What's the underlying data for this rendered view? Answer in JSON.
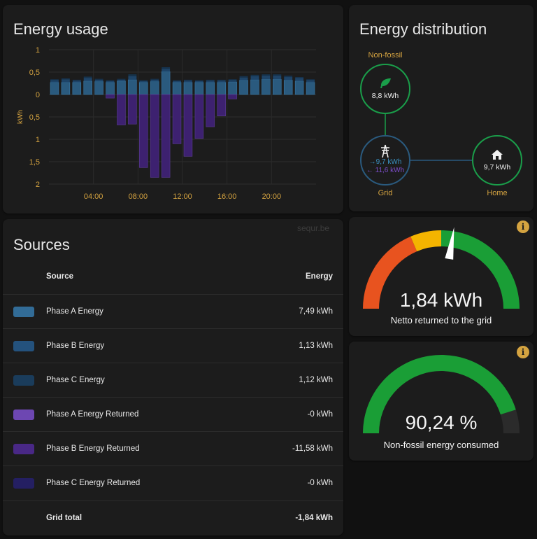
{
  "usage": {
    "title": "Energy usage",
    "unit": "kWh",
    "chart_data": {
      "type": "bar",
      "categories": [
        "00",
        "01",
        "02",
        "03",
        "04",
        "05",
        "06",
        "07",
        "08",
        "09",
        "10",
        "11",
        "12",
        "13",
        "14",
        "15",
        "16",
        "17",
        "18",
        "19",
        "20",
        "21",
        "22",
        "23"
      ],
      "x_tick_labels": [
        "04:00",
        "08:00",
        "12:00",
        "16:00",
        "20:00"
      ],
      "y_tick_labels": [
        "1",
        "0,5",
        "0",
        "0,5",
        "1",
        "1,5",
        "2"
      ],
      "ylim": [
        -2,
        1
      ],
      "series": [
        {
          "name": "Phase A Energy",
          "color": "#2a5a7e",
          "values": [
            0.27,
            0.27,
            0.27,
            0.3,
            0.29,
            0.27,
            0.3,
            0.33,
            0.27,
            0.29,
            0.51,
            0.27,
            0.27,
            0.27,
            0.27,
            0.27,
            0.28,
            0.32,
            0.33,
            0.34,
            0.34,
            0.32,
            0.3,
            0.27
          ]
        },
        {
          "name": "Phase B Energy",
          "color": "#1e4468",
          "values": [
            0.05,
            0.07,
            0.04,
            0.07,
            0.04,
            0.03,
            0.03,
            0.08,
            0.03,
            0.04,
            0.06,
            0.03,
            0.04,
            0.03,
            0.04,
            0.04,
            0.04,
            0.06,
            0.08,
            0.08,
            0.08,
            0.07,
            0.07,
            0.05
          ]
        },
        {
          "name": "Phase C Energy",
          "color": "#16324c",
          "values": [
            0.02,
            0.02,
            0.02,
            0.03,
            0.02,
            0.02,
            0.02,
            0.04,
            0.02,
            0.02,
            0.04,
            0.02,
            0.02,
            0.02,
            0.02,
            0.02,
            0.02,
            0.03,
            0.03,
            0.03,
            0.03,
            0.03,
            0.02,
            0.02
          ]
        },
        {
          "name": "Phase B Energy Returned",
          "color": "#3d2170",
          "values": [
            0,
            0,
            0,
            0,
            0,
            -0.08,
            -0.68,
            -0.66,
            -1.63,
            -1.85,
            -1.85,
            -1.1,
            -1.38,
            -0.98,
            -0.72,
            -0.48,
            -0.1,
            0,
            0,
            0,
            0,
            0,
            0,
            0
          ]
        }
      ]
    }
  },
  "distribution": {
    "title": "Energy distribution",
    "nonfossil": {
      "label": "Non-fossil",
      "value": "8,8 kWh",
      "icon": "leaf-icon"
    },
    "grid": {
      "label": "Grid",
      "in": "→9,7 kWh",
      "out": "← 11,6 kWh",
      "icon": "transmission-tower-icon"
    },
    "home": {
      "label": "Home",
      "value": "9,7 kWh",
      "icon": "home-icon"
    }
  },
  "sources": {
    "title": "Sources",
    "header": {
      "source": "Source",
      "energy": "Energy"
    },
    "rows": [
      {
        "name": "Phase A Energy",
        "value": "7,49 kWh",
        "color": "#2a5a7e"
      },
      {
        "name": "Phase B Energy",
        "value": "1,13 kWh",
        "color": "#1e4468"
      },
      {
        "name": "Phase C Energy",
        "value": "1,12 kWh",
        "color": "#16324c"
      },
      {
        "name": "Phase A Energy Returned",
        "value": "-0 kWh",
        "color": "#5b3b94"
      },
      {
        "name": "Phase B Energy Returned",
        "value": "-11,58 kWh",
        "color": "#3d2170"
      },
      {
        "name": "Phase C Energy Returned",
        "value": "-0 kWh",
        "color": "#1e1a52"
      }
    ],
    "total": {
      "name": "Grid total",
      "value": "-1,84 kWh"
    }
  },
  "watermark": "sequr.be",
  "gauge_returned": {
    "value": "1,84 kWh",
    "name": "Netto returned to the grid",
    "needle_fraction": 0.55,
    "colors": [
      "#e8531f",
      "#f4b400",
      "#1a9e36"
    ]
  },
  "gauge_nonfossil": {
    "value": "90,24 %",
    "name": "Non-fossil energy consumed",
    "fill_fraction": 0.9024,
    "colors": [
      "#1a9e36",
      "#2b2b2b"
    ]
  }
}
